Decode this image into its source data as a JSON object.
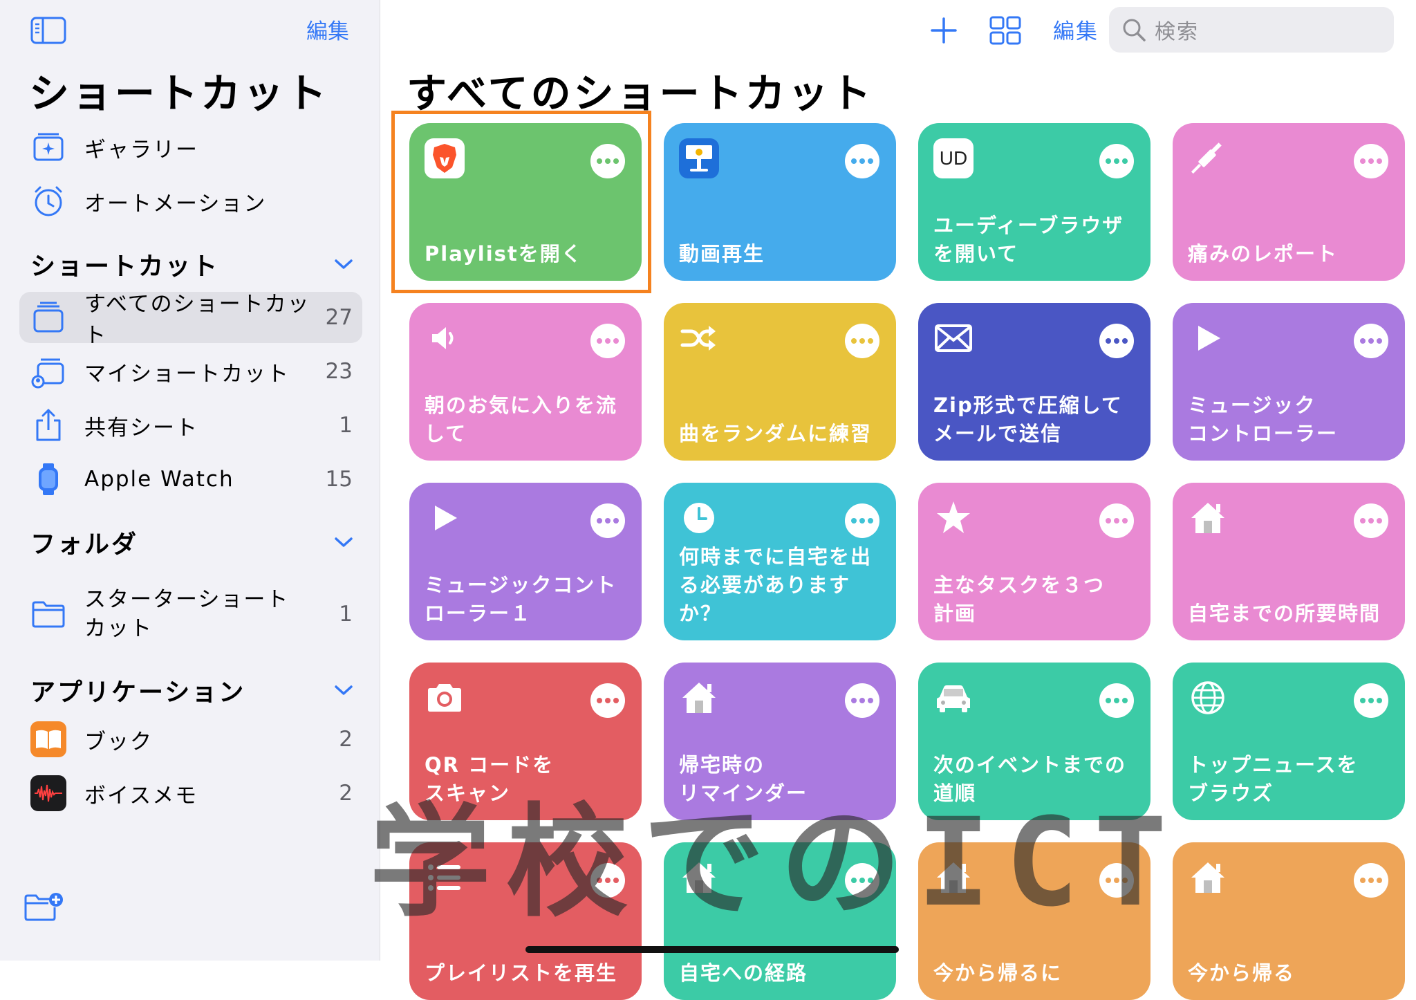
{
  "sidebar": {
    "edit_label": "編集",
    "title": "ショートカット",
    "top_items": [
      {
        "label": "ギャラリー",
        "icon": "gallery-icon"
      },
      {
        "label": "オートメーション",
        "icon": "automation-clock-icon"
      }
    ],
    "shortcuts_section": {
      "header": "ショートカット",
      "items": [
        {
          "label": "すべてのショートカット",
          "count": "27",
          "icon": "all-shortcuts-icon",
          "selected": true
        },
        {
          "label": "マイショートカット",
          "count": "23",
          "icon": "my-shortcuts-icon"
        },
        {
          "label": "共有シート",
          "count": "1",
          "icon": "share-sheet-icon"
        },
        {
          "label": "Apple Watch",
          "count": "15",
          "icon": "apple-watch-icon"
        }
      ]
    },
    "folders_section": {
      "header": "フォルダ",
      "items": [
        {
          "label": "スターターショート\nカット",
          "count": "1",
          "icon": "folder-icon"
        }
      ]
    },
    "apps_section": {
      "header": "アプリケーション",
      "items": [
        {
          "label": "ブック",
          "count": "2",
          "icon": "books-app-icon"
        },
        {
          "label": "ボイスメモ",
          "count": "2",
          "icon": "voice-memos-app-icon"
        }
      ]
    }
  },
  "toolbar": {
    "edit_label": "編集",
    "search_placeholder": "検索"
  },
  "main": {
    "title": "すべてのショートカット",
    "tiles": [
      {
        "name": "Playlistを開く",
        "color": "#6cc46e",
        "icon": "brave-lion-icon",
        "highlighted": true
      },
      {
        "name": "動画再生",
        "color": "#45abec",
        "icon": "keynote-icon"
      },
      {
        "name": "ユーディーブラウザ\nを開いて",
        "color": "#3ccba6",
        "icon": "ud-icon",
        "icon_text": "UD"
      },
      {
        "name": "痛みのレポート",
        "color": "#e98ad2",
        "icon": "syringe-icon"
      },
      {
        "name": "朝のお気に入りを流\nして",
        "color": "#e98ad2",
        "icon": "speaker-icon"
      },
      {
        "name": "曲をランダムに練習",
        "color": "#e8c33c",
        "icon": "shuffle-icon"
      },
      {
        "name": "Zip形式で圧縮して\nメールで送信",
        "color": "#4a56c4",
        "icon": "envelope-icon"
      },
      {
        "name": "ミュージック\nコントローラー",
        "color": "#aa7ae0",
        "icon": "play-icon"
      },
      {
        "name": "ミュージックコント\nローラー１",
        "color": "#aa7ae0",
        "icon": "play-icon"
      },
      {
        "name": "何時までに自宅を出\nる必要があります\nか？",
        "color": "#3fc3d6",
        "icon": "clock-icon"
      },
      {
        "name": "主なタスクを３つ\n計画",
        "color": "#e98ad2",
        "icon": "star-icon"
      },
      {
        "name": "自宅までの所要時間",
        "color": "#e98ad2",
        "icon": "house-icon"
      },
      {
        "name": "QR コードを\nスキャン",
        "color": "#e35d62",
        "icon": "camera-icon"
      },
      {
        "name": "帰宅時の\nリマインダー",
        "color": "#aa7ae0",
        "icon": "house-icon"
      },
      {
        "name": "次のイベントまでの\n道順",
        "color": "#3ccba6",
        "icon": "car-icon"
      },
      {
        "name": "トップニュースを\nブラウズ",
        "color": "#3ccba6",
        "icon": "globe-icon"
      },
      {
        "name": "プレイリストを再生",
        "color": "#e35d62",
        "icon": "list-icon"
      },
      {
        "name": "自宅への経路",
        "color": "#3ccba6",
        "icon": "house-icon"
      },
      {
        "name": "今から帰るに",
        "color": "#eea558",
        "icon": "house-icon"
      },
      {
        "name": "今から帰る",
        "color": "#eea558",
        "icon": "house-icon"
      }
    ]
  },
  "watermark": "学校でのICT",
  "colors": {
    "accent": "#3478f6",
    "highlight": "#f5821f"
  }
}
